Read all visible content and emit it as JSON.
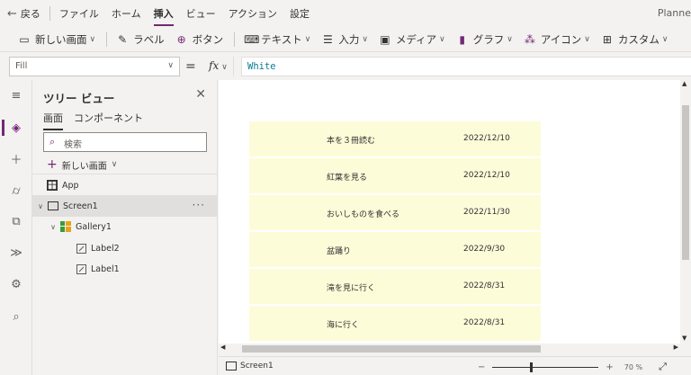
{
  "menubar": {
    "back_label": "戻る",
    "items": [
      "ファイル",
      "ホーム",
      "挿入",
      "ビュー",
      "アクション",
      "設定"
    ],
    "active_index": 2,
    "app_name": "Planne"
  },
  "toolbar": {
    "items": [
      {
        "label": "新しい画面",
        "icon": "screen-icon",
        "dropdown": true
      },
      {
        "label": "ラベル",
        "icon": "label-icon",
        "dropdown": false
      },
      {
        "label": "ボタン",
        "icon": "button-icon",
        "dropdown": false
      },
      {
        "label": "テキスト",
        "icon": "text-icon",
        "dropdown": true
      },
      {
        "label": "入力",
        "icon": "input-icon",
        "dropdown": true
      },
      {
        "label": "メディア",
        "icon": "media-icon",
        "dropdown": true
      },
      {
        "label": "グラフ",
        "icon": "chart-icon",
        "dropdown": true
      },
      {
        "label": "アイコン",
        "icon": "icons-icon",
        "dropdown": true
      },
      {
        "label": "カスタム",
        "icon": "custom-icon",
        "dropdown": true
      }
    ]
  },
  "formulabar": {
    "property": "Fill",
    "equals": "=",
    "fx": "fx",
    "formula": "White"
  },
  "tree": {
    "title": "ツリー ビュー",
    "tabs": [
      "画面",
      "コンポーネント"
    ],
    "active_tab": 0,
    "search_placeholder": "検索",
    "new_screen_label": "新しい画面",
    "nodes": [
      {
        "label": "App",
        "icon": "app-icon",
        "level": 0
      },
      {
        "label": "Screen1",
        "icon": "screen-icon",
        "level": 0,
        "selected": true
      },
      {
        "label": "Gallery1",
        "icon": "gallery-icon",
        "level": 1
      },
      {
        "label": "Label2",
        "icon": "label-icon",
        "level": 2
      },
      {
        "label": "Label1",
        "icon": "label-icon",
        "level": 2
      }
    ],
    "more_label": "···"
  },
  "gallery": {
    "rows": [
      {
        "title": "本を３冊読む",
        "date": "2022/12/10"
      },
      {
        "title": "紅葉を見る",
        "date": "2022/12/10"
      },
      {
        "title": "おいしものを食べる",
        "date": "2022/11/30"
      },
      {
        "title": "盆踊り",
        "date": "2022/9/30"
      },
      {
        "title": "滝を見に行く",
        "date": "2022/8/31"
      },
      {
        "title": "海に行く",
        "date": "2022/8/31"
      }
    ],
    "row_color": "#fdfcd9"
  },
  "statusbar": {
    "screen_name": "Screen1",
    "zoom_minus": "−",
    "zoom_plus": "+",
    "zoom_percent": "70 %",
    "zoom_value": 70
  },
  "colors": {
    "accent": "#742774",
    "formula_text": "#0a7a8f"
  }
}
